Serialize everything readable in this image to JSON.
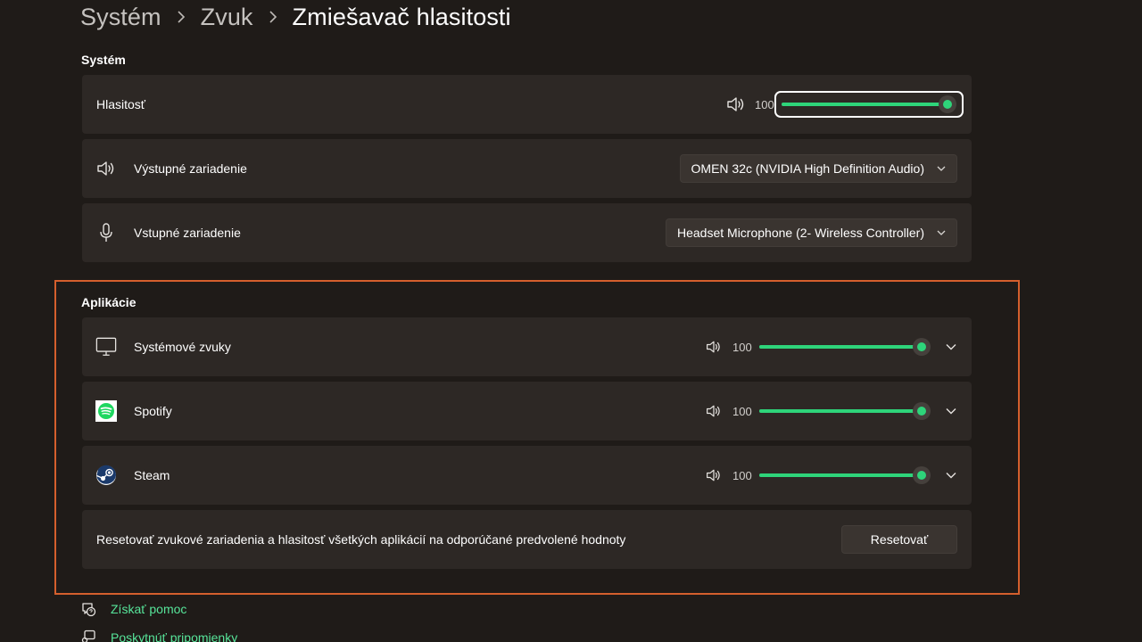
{
  "breadcrumb": {
    "items": [
      "Systém",
      "Zvuk"
    ],
    "current": "Zmiešavač hlasitosti"
  },
  "system": {
    "heading": "Systém",
    "volume": {
      "label": "Hlasitosť",
      "value": "100",
      "level": 1.0
    },
    "output": {
      "label": "Výstupné zariadenie",
      "selected": "OMEN 32c (NVIDIA High Definition Audio)"
    },
    "input": {
      "label": "Vstupné zariadenie",
      "selected": "Headset Microphone (2- Wireless Controller)"
    }
  },
  "apps": {
    "heading": "Aplikácie",
    "items": [
      {
        "name": "Systémové zvuky",
        "value": "100",
        "level": 1.0,
        "icon": "monitor-icon"
      },
      {
        "name": "Spotify",
        "value": "100",
        "level": 1.0,
        "icon": "spotify-icon"
      },
      {
        "name": "Steam",
        "value": "100",
        "level": 1.0,
        "icon": "steam-icon"
      }
    ],
    "reset": {
      "text": "Resetovať zvukové zariadenia a hlasitosť všetkých aplikácií na odporúčané predvolené hodnoty",
      "button_label": "Resetovať"
    }
  },
  "footer": {
    "help": "Získať pomoc",
    "feedback": "Poskytnúť pripomienky"
  },
  "colors": {
    "accent": "#2ed47a",
    "highlight": "#d45f2d",
    "link": "#57e59a"
  }
}
